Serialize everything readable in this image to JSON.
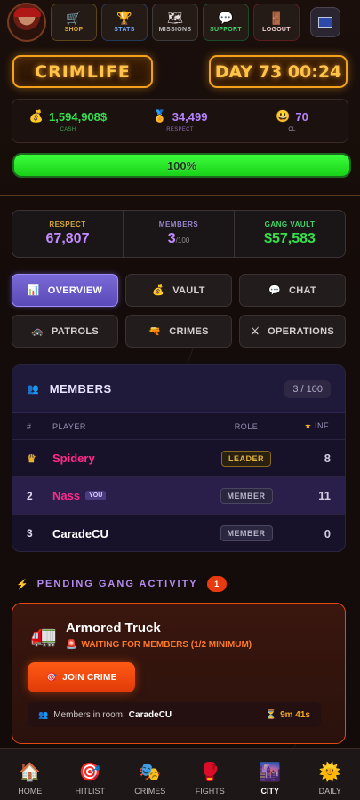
{
  "topnav": {
    "items": [
      {
        "label": "SHOP",
        "icon": "cart-icon"
      },
      {
        "label": "STATS",
        "icon": "trophy-icon"
      },
      {
        "label": "MISSIONS",
        "icon": "map-icon"
      },
      {
        "label": "SUPPORT",
        "icon": "chat-bubble-icon"
      },
      {
        "label": "LOGOUT",
        "icon": "door-icon"
      }
    ]
  },
  "brand": {
    "title": "CRIMLIFE",
    "day": "DAY 73 00:24"
  },
  "player_stats": {
    "cash": {
      "value": "1,594,908$",
      "label": "CASH"
    },
    "respect": {
      "value": "34,499",
      "label": "RESPECT"
    },
    "cl": {
      "value": "70",
      "label": "CL"
    }
  },
  "progress": {
    "label": "100%",
    "percent": 100
  },
  "gang_stats": {
    "respect": {
      "label": "RESPECT",
      "value": "67,807"
    },
    "members": {
      "label": "MEMBERS",
      "value": "3",
      "max": "/100"
    },
    "vault": {
      "label": "GANG VAULT",
      "value": "$57,583"
    }
  },
  "tabs": [
    {
      "label": "OVERVIEW",
      "icon": "chart-icon"
    },
    {
      "label": "VAULT",
      "icon": "money-bag-icon"
    },
    {
      "label": "CHAT",
      "icon": "chat-icon"
    },
    {
      "label": "PATROLS",
      "icon": "police-car-icon"
    },
    {
      "label": "CRIMES",
      "icon": "gun-icon"
    },
    {
      "label": "OPERATIONS",
      "icon": "swords-icon"
    }
  ],
  "members": {
    "title": "MEMBERS",
    "count": "3 / 100",
    "columns": {
      "rank": "#",
      "player": "PLAYER",
      "role": "ROLE",
      "inf": "INF."
    },
    "rows": [
      {
        "rank": "",
        "name": "Spidery",
        "role": "LEADER",
        "inf": "8"
      },
      {
        "rank": "2",
        "name": "Nass",
        "tag": "YOU",
        "role": "MEMBER",
        "inf": "11"
      },
      {
        "rank": "3",
        "name": "CaradeCU",
        "role": "MEMBER",
        "inf": "0"
      }
    ]
  },
  "pending": {
    "title": "PENDING GANG ACTIVITY",
    "count": "1"
  },
  "crime": {
    "name": "Armored Truck",
    "status": "WAITING FOR MEMBERS (1/2 MINIMUM)",
    "join_label": "JOIN CRIME",
    "room_label": "Members in room:",
    "room_members": "CaradeCU",
    "timer": "9m 41s"
  },
  "bottomnav": [
    {
      "label": "HOME",
      "icon": "house-icon"
    },
    {
      "label": "HITLIST",
      "icon": "target-icon"
    },
    {
      "label": "CRIMES",
      "icon": "masks-icon"
    },
    {
      "label": "FIGHTS",
      "icon": "boxing-glove-icon"
    },
    {
      "label": "CITY",
      "icon": "city-icon"
    },
    {
      "label": "DAILY",
      "icon": "sun-icon"
    }
  ],
  "colors": {
    "accent_orange": "#f3a11c",
    "cash_green": "#35e04c",
    "respect_purple": "#b683ff",
    "active_tab": "#6a5ac8",
    "crime_orange": "#ff5a14"
  }
}
